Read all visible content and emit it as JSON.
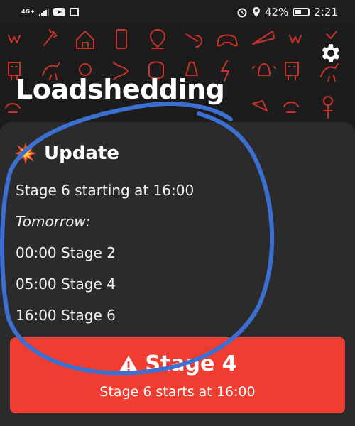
{
  "status_bar": {
    "network": "4G+",
    "battery_percent": "42%",
    "battery_level": 0.42,
    "time": "2:21"
  },
  "header": {
    "title": "Loadshedding"
  },
  "update": {
    "heading": "Update",
    "current": "Stage 6 starting at 16:00",
    "tomorrow_label": "Tomorrow:",
    "schedule": [
      "00:00 Stage 2",
      "05:00 Stage 4",
      "16:00 Stage 6"
    ]
  },
  "stage_card": {
    "title": "Stage 4",
    "subtitle": "Stage 6 starts at 16:00"
  },
  "colors": {
    "background": "#1e1e1e",
    "card": "#2b2b2b",
    "accent_red": "#f03d32",
    "doodle_red": "#c8322a",
    "annotation_blue": "#3b6fd1"
  }
}
